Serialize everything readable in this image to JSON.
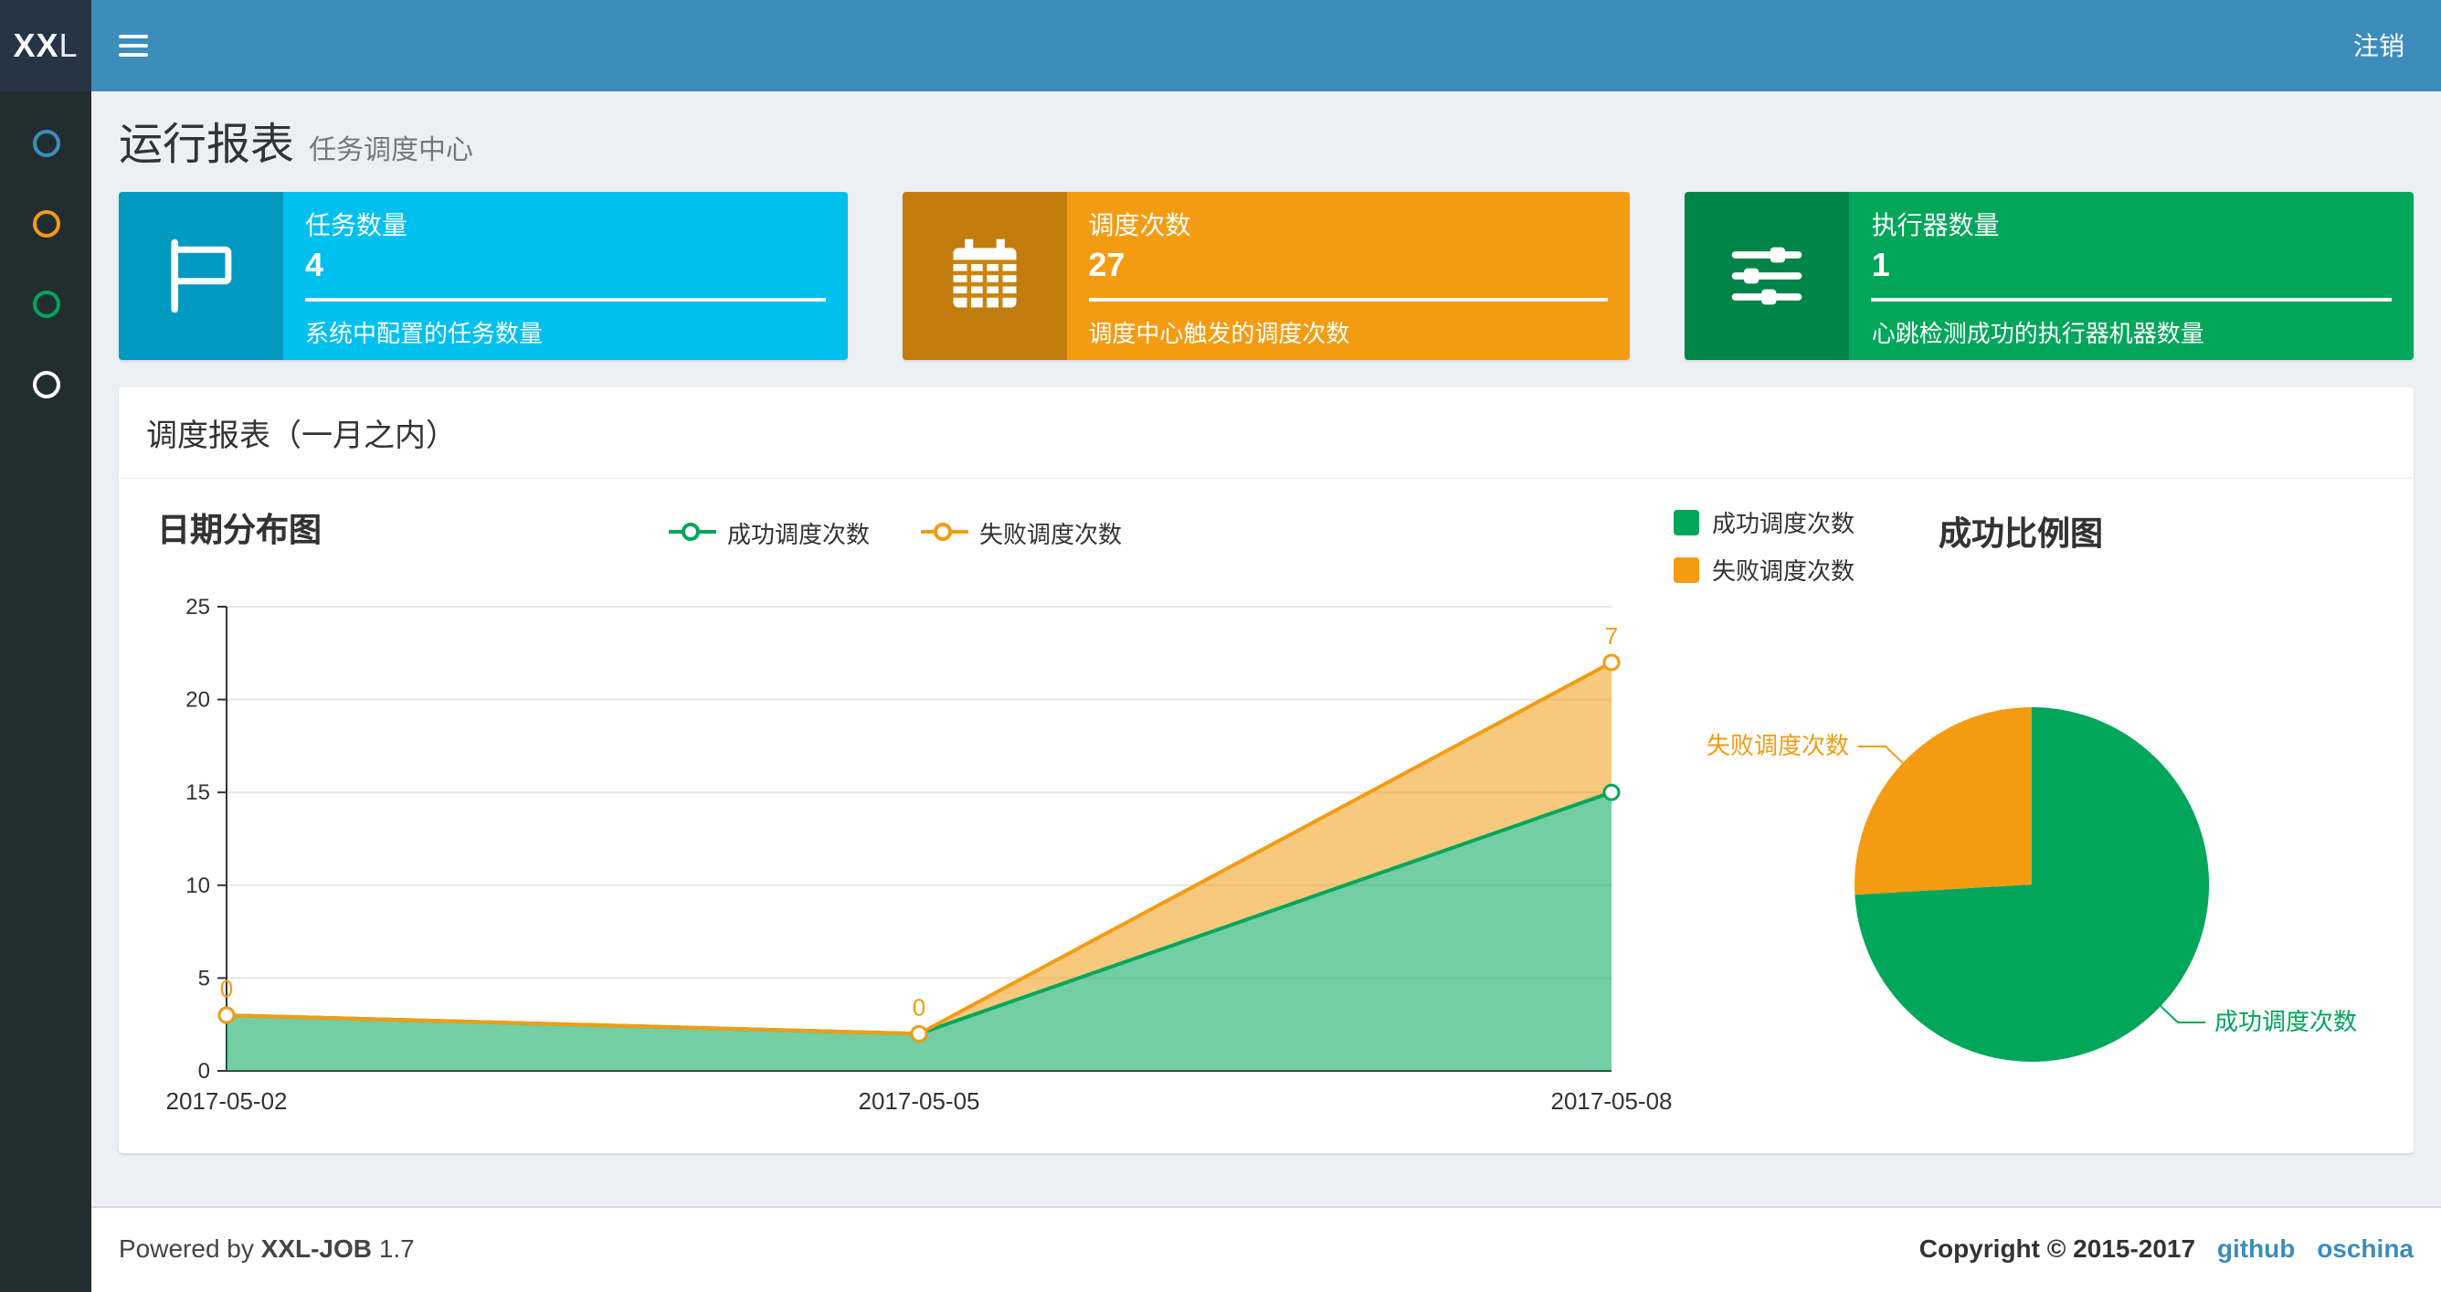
{
  "navbar": {
    "logo_bold": "XX",
    "logo_light": "L",
    "logout": "注销"
  },
  "sidebar": {
    "items": [
      {
        "icon": "circle-icon",
        "color": "#3c8dbc"
      },
      {
        "icon": "circle-icon",
        "color": "#f39c12"
      },
      {
        "icon": "circle-icon",
        "color": "#00a65a"
      },
      {
        "icon": "circle-icon",
        "color": "#ffffff"
      }
    ]
  },
  "header": {
    "title": "运行报表",
    "subtitle": "任务调度中心"
  },
  "info_boxes": [
    {
      "title": "任务数量",
      "value": "4",
      "desc": "系统中配置的任务数量",
      "color": "#00c0ef",
      "icon": "flag-icon"
    },
    {
      "title": "调度次数",
      "value": "27",
      "desc": "调度中心触发的调度次数",
      "color": "#f39c12",
      "icon": "calendar-icon"
    },
    {
      "title": "执行器数量",
      "value": "1",
      "desc": "心跳检测成功的执行器机器数量",
      "color": "#00a65a",
      "icon": "sliders-icon"
    }
  ],
  "panel": {
    "title": "调度报表（一月之内）"
  },
  "chart_data": [
    {
      "type": "area",
      "title": "日期分布图",
      "stacked": true,
      "x": [
        "2017-05-02",
        "2017-05-05",
        "2017-05-08"
      ],
      "series": [
        {
          "name": "成功调度次数",
          "color": "#00a65a",
          "values": [
            3,
            2,
            15
          ]
        },
        {
          "name": "失败调度次数",
          "color": "#f39c12",
          "values": [
            0,
            0,
            7
          ]
        }
      ],
      "point_labels": {
        "series": "失败调度次数",
        "values": [
          0,
          0,
          7
        ]
      },
      "ylim": [
        0,
        25
      ],
      "ytick": 5,
      "grid": true,
      "legend_position": "top-center"
    },
    {
      "type": "pie",
      "title": "成功比例图",
      "slices": [
        {
          "name": "成功调度次数",
          "color": "#00a65a",
          "value": 20
        },
        {
          "name": "失败调度次数",
          "color": "#f39c12",
          "value": 7
        }
      ],
      "legend_position": "top-left"
    }
  ],
  "footer": {
    "powered": "Powered by",
    "brand": "XXL-JOB",
    "version": "1.7",
    "copyright": "Copyright © 2015-2017",
    "link_github": "github",
    "link_oschina": "oschina"
  }
}
